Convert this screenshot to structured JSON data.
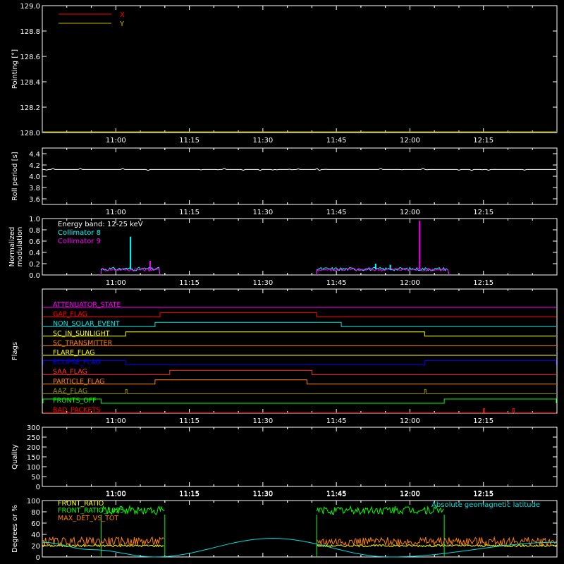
{
  "x_ticks": [
    "11:00",
    "11:15",
    "11:30",
    "11:45",
    "12:00",
    "12:15"
  ],
  "chart_data": [
    {
      "type": "line",
      "ylabel": "Pointing [°]",
      "ylim": [
        128.0,
        129.0
      ],
      "yticks": [
        "128.0",
        "128.2",
        "128.4",
        "128.6",
        "128.8",
        "129.0"
      ],
      "legend_position": "top-left",
      "series": [
        {
          "name": "X",
          "color": "#ff0000",
          "values": []
        },
        {
          "name": "Y",
          "color": "#c8b400",
          "values": []
        }
      ]
    },
    {
      "type": "line",
      "ylabel": "Roll period [s]",
      "ylim": [
        3.5,
        4.5
      ],
      "yticks": [
        "3.6",
        "3.8",
        "4.0",
        "4.2",
        "4.4"
      ],
      "series": [
        {
          "color": "#ffffff",
          "x": [
            "10:45",
            "12:30"
          ],
          "values": [
            4.12,
            4.12
          ]
        }
      ]
    },
    {
      "type": "line",
      "ylabel": [
        "Normalized",
        "modulation"
      ],
      "ylim": [
        0,
        1.0
      ],
      "yticks": [
        "0.0",
        "0.2",
        "0.4",
        "0.6",
        "0.8",
        "1.0"
      ],
      "annotation": "Energy band: 12-25 keV",
      "series": [
        {
          "name": "Collimator 8",
          "color": "#00ffff",
          "segments": [
            [
              "10:57",
              "11:09"
            ],
            [
              "11:41",
              "12:08"
            ]
          ],
          "baseline": 0.1,
          "spikes": [
            [
              "11:03",
              0.68
            ],
            [
              "11:53",
              0.2
            ],
            [
              "11:56",
              0.18
            ]
          ]
        },
        {
          "name": "Collimator 9",
          "color": "#ff00ff",
          "segments": [
            [
              "10:57",
              "11:09"
            ],
            [
              "11:41",
              "12:08"
            ]
          ],
          "baseline": 0.09,
          "spikes": [
            [
              "11:07",
              0.25
            ],
            [
              "12:02",
              0.96
            ]
          ]
        }
      ]
    },
    {
      "type": "flags",
      "ylabel": "Flags",
      "flags": [
        {
          "name": "ATTENUATOR_STATE",
          "color": "#ff00ff",
          "high": []
        },
        {
          "name": "GAP_FLAG",
          "color": "#ff0000",
          "high": [
            [
              "11:09",
              "11:41"
            ]
          ]
        },
        {
          "name": "NON_SOLAR_EVENT",
          "color": "#00e0e0",
          "high": [
            [
              "11:08",
              "11:46"
            ]
          ]
        },
        {
          "name": "SC_IN_SUNLIGHT",
          "color": "#ffff00",
          "high": [
            [
              "11:02",
              "12:03"
            ]
          ]
        },
        {
          "name": "SC_TRANSMITTER",
          "color": "#ff8000",
          "high": []
        },
        {
          "name": "FLARE_FLAG",
          "color": "#ffff00",
          "high": []
        },
        {
          "name": "ECLIPSE_FLAG",
          "color": "#0000ff",
          "high": [
            [
              "10:45",
              "11:02"
            ],
            [
              "12:03",
              "12:30"
            ]
          ]
        },
        {
          "name": "SAA_FLAG",
          "color": "#ff3030",
          "high": [
            [
              "11:11",
              "11:40"
            ]
          ]
        },
        {
          "name": "PARTICLE_FLAG",
          "color": "#ff8000",
          "high": [
            [
              "11:08",
              "11:39"
            ]
          ]
        },
        {
          "name": "AAZ_FLAG",
          "color": "#909000",
          "high": [
            [
              "11:02",
              "11:02"
            ],
            [
              "12:03",
              "12:03"
            ]
          ]
        },
        {
          "name": "FRONTS_OFF",
          "color": "#00ff00",
          "high": [
            [
              "10:45",
              "10:57"
            ],
            [
              "12:07",
              "12:30"
            ]
          ]
        },
        {
          "name": "BAD_PACKETS",
          "color": "#ff0000",
          "high": [
            [
              "12:15",
              "12:15"
            ],
            [
              "12:21",
              "12:21"
            ]
          ]
        }
      ]
    },
    {
      "type": "line",
      "ylabel": "Quality",
      "ylim": [
        0,
        300
      ],
      "yticks": [
        "0",
        "50",
        "100",
        "150",
        "200",
        "250",
        "300"
      ],
      "series": []
    },
    {
      "type": "line",
      "ylabel": "Degrees or %",
      "ylim": [
        0,
        100
      ],
      "yticks": [
        "0",
        "20",
        "40",
        "60",
        "80",
        "100"
      ],
      "series": [
        {
          "name": "FRONT_RATIO",
          "color": "#ffff00",
          "segments": [
            [
              "10:45",
              "11:10"
            ],
            [
              "11:41",
              "12:30"
            ]
          ],
          "values": [
            18,
            22
          ]
        },
        {
          "name": "FRONT_RATIO_1025",
          "color": "#00ff00",
          "segments": [
            [
              "10:57",
              "11:10"
            ],
            [
              "11:41",
              "12:07"
            ]
          ],
          "values": [
            75,
            90
          ]
        },
        {
          "name": "MAX_DET_VS_TOT",
          "color": "#ff8000",
          "segments": [
            [
              "10:45",
              "11:10"
            ],
            [
              "11:41",
              "12:30"
            ]
          ],
          "values": [
            20,
            35
          ]
        },
        {
          "name": "Absolute geomagnetic latitude",
          "color": "#00e0e0",
          "x": [
            "10:45",
            "10:55",
            "11:08",
            "11:32",
            "11:56",
            "12:30"
          ],
          "values": [
            26,
            13,
            0,
            33,
            0,
            26
          ]
        }
      ]
    }
  ]
}
